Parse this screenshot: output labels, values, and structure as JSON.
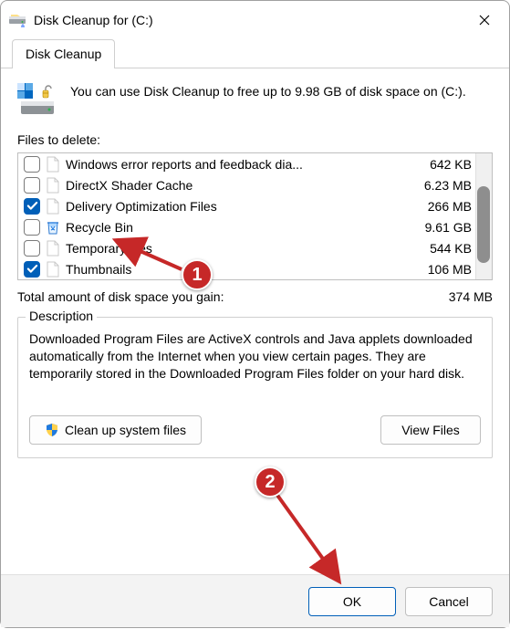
{
  "window": {
    "title": "Disk Cleanup for  (C:)"
  },
  "tab": {
    "label": "Disk Cleanup"
  },
  "intro": "You can use Disk Cleanup to free up to 9.98 GB of disk space on  (C:).",
  "files_label": "Files to delete:",
  "items": [
    {
      "checked": false,
      "icon": "doc",
      "name": "Windows error reports and feedback dia...",
      "size": "642 KB"
    },
    {
      "checked": false,
      "icon": "doc",
      "name": "DirectX Shader Cache",
      "size": "6.23 MB"
    },
    {
      "checked": true,
      "icon": "doc",
      "name": "Delivery Optimization Files",
      "size": "266 MB"
    },
    {
      "checked": false,
      "icon": "bin",
      "name": "Recycle Bin",
      "size": "9.61 GB"
    },
    {
      "checked": false,
      "icon": "doc",
      "name": "Temporary files",
      "size": "544 KB"
    },
    {
      "checked": true,
      "icon": "doc",
      "name": "Thumbnails",
      "size": "106 MB"
    }
  ],
  "total": {
    "label": "Total amount of disk space you gain:",
    "value": "374 MB"
  },
  "description": {
    "title": "Description",
    "body": "Downloaded Program Files are ActiveX controls and Java applets downloaded automatically from the Internet when you view certain pages. They are temporarily stored in the Downloaded Program Files folder on your hard disk."
  },
  "buttons": {
    "cleanup": "Clean up system files",
    "viewfiles": "View Files",
    "ok": "OK",
    "cancel": "Cancel"
  },
  "annotations": {
    "tag1": "1",
    "tag2": "2"
  }
}
